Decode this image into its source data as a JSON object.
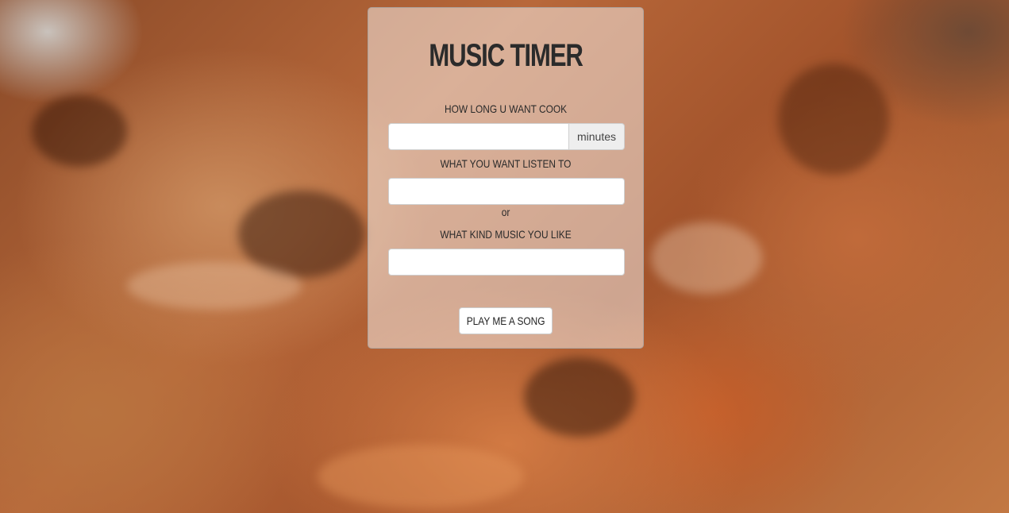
{
  "app": {
    "title": "MUSIC TIMER"
  },
  "form": {
    "cook_label": "HOW LONG U WANT COOK",
    "cook_input_value": "",
    "cook_unit": "minutes",
    "listen_label": "WHAT YOU WANT LISTEN TO",
    "listen_input_value": "",
    "or_text": "or",
    "genre_label": "WHAT KIND MUSIC YOU LIKE",
    "genre_input_value": "",
    "submit_label": "PLAY ME A SONG"
  }
}
